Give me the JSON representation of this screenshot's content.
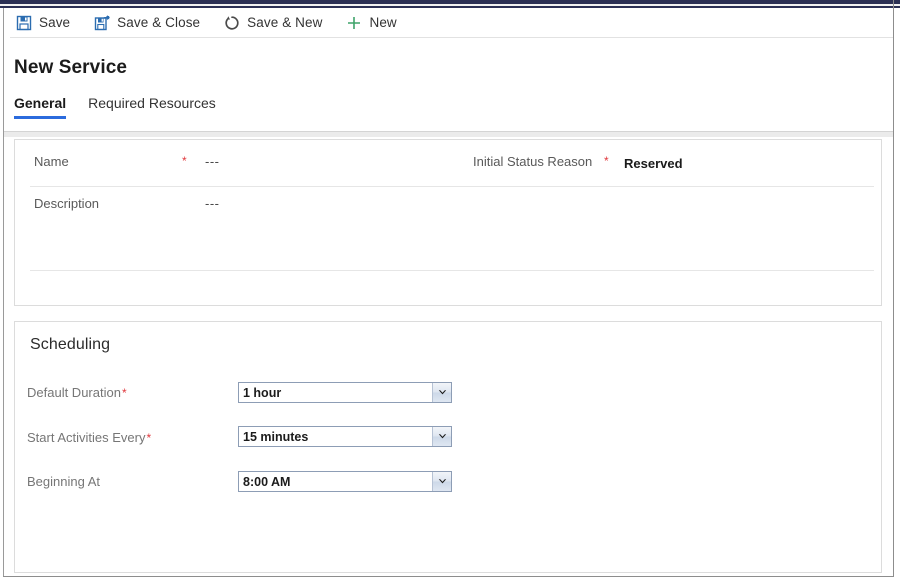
{
  "window": {
    "accent_navy": "#2b3054",
    "accent_blue": "#2b6bdd",
    "required_red": "#e0393e"
  },
  "commandbar": {
    "items": [
      {
        "label": "Save",
        "icon": "save-icon"
      },
      {
        "label": "Save & Close",
        "icon": "save-and-close-icon"
      },
      {
        "label": "Save & New",
        "icon": "save-and-new-icon"
      },
      {
        "label": "New",
        "icon": "plus-icon"
      }
    ]
  },
  "header": {
    "title": "New Service",
    "tabs": [
      {
        "label": "General",
        "active": true
      },
      {
        "label": "Required Resources",
        "active": false
      }
    ]
  },
  "general": {
    "fields": {
      "name": {
        "label": "Name",
        "value": "---",
        "required": true,
        "required_marker": "*"
      },
      "description": {
        "label": "Description",
        "value": "---",
        "required": false
      },
      "initial_status_reason": {
        "label": "Initial Status Reason",
        "value": "Reserved",
        "required": true,
        "required_marker": "*"
      }
    }
  },
  "scheduling": {
    "section_title": "Scheduling",
    "fields": [
      {
        "label": "Default Duration",
        "required": true,
        "required_marker": "*",
        "value": "1 hour",
        "control": "dropdown"
      },
      {
        "label": "Start Activities Every",
        "required": true,
        "required_marker": "*",
        "value": "15 minutes",
        "control": "dropdown"
      },
      {
        "label": "Beginning At",
        "required": false,
        "required_marker": "",
        "value": "8:00 AM",
        "control": "dropdown"
      }
    ]
  }
}
